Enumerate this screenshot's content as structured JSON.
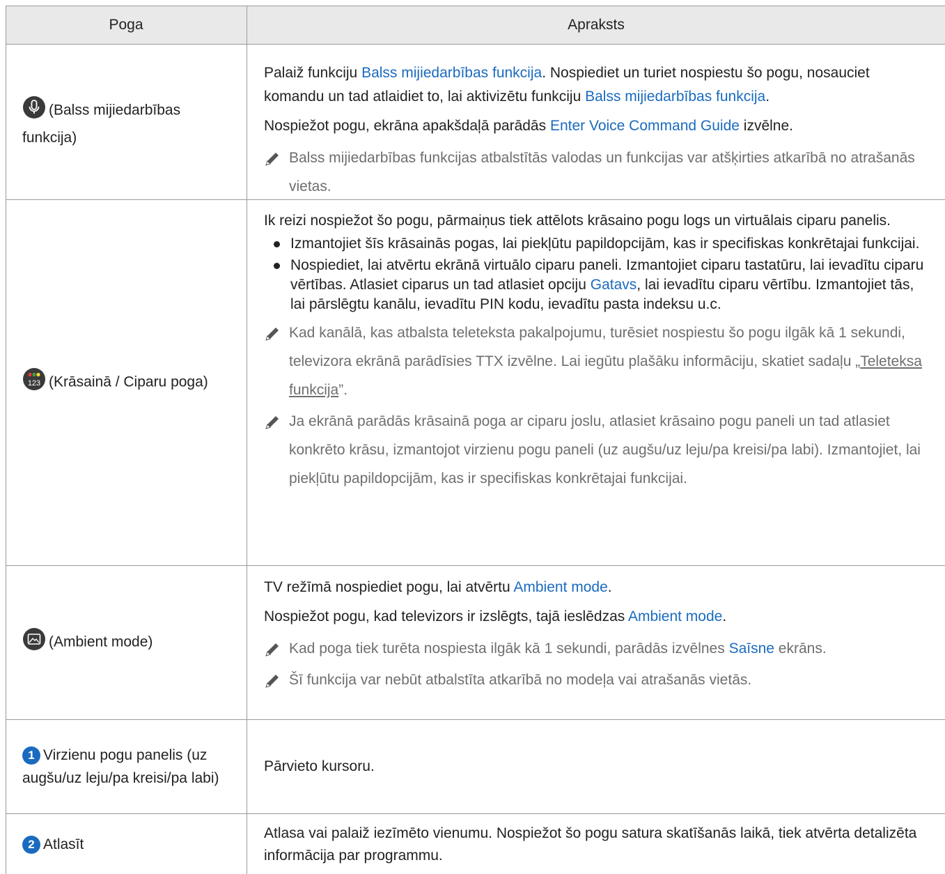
{
  "header": {
    "col_button": "Poga",
    "col_desc": "Apraksts"
  },
  "rows": [
    {
      "button": "(Balss mijiedarbības funkcija)",
      "icon": "microphone-icon",
      "desc": {
        "p1_a": "Palaiž funkciju ",
        "p1_link1": "Balss mijiedarbības funkcija",
        "p1_b": ". Nospiediet un turiet nospiestu šo pogu, nosauciet komandu un tad atlaidiet to, lai aktivizētu funkciju ",
        "p1_link2": "Balss mijiedarbības funkcija",
        "p1_c": ".",
        "p2_a": "Nospiežot pogu, ekrāna apakšdaļā parādās ",
        "p2_link": "Enter Voice Command Guide",
        "p2_b": " izvēlne.",
        "note1": "Balss mijiedarbības funkcijas atbalstītās valodas un funkcijas var atšķirties atkarībā no atrašanās vietas."
      }
    },
    {
      "button": "(Krāsainā / Ciparu poga)",
      "icon": "color-number-icon",
      "icon_text": "123",
      "desc": {
        "p1": "Ik reizi nospiežot šo pogu, pārmaiņus tiek attēlots krāsaino pogu logs un virtuālais ciparu panelis.",
        "b1": "Izmantojiet šīs krāsainās pogas, lai piekļūtu papildopcijām, kas ir specifiskas konkrētajai funkcijai.",
        "b2_a": "Nospiediet, lai atvērtu ekrānā virtuālo ciparu paneli. Izmantojiet ciparu tastatūru, lai ievadītu ciparu vērtības. Atlasiet ciparus un tad atlasiet opciju ",
        "b2_link": "Gatavs",
        "b2_b": ", lai ievadītu ciparu vērtību. Izmantojiet tās, lai pārslēgtu kanālu, ievadītu PIN kodu, ievadītu pasta indeksu u.c.",
        "note1_a": "Kad kanālā, kas atbalsta teleteksta pakalpojumu, turēsiet nospiestu šo pogu ilgāk kā 1 sekundi, televizora ekrānā parādīsies TTX izvēlne. Lai iegūtu plašāku informāciju, skatiet sadaļu „",
        "note1_link": "Teleteksa funkcija",
        "note1_b": "”.",
        "note2": "Ja ekrānā parādās krāsainā poga ar ciparu joslu, atlasiet krāsaino pogu paneli un tad atlasiet konkrēto krāsu, izmantojot virzienu pogu paneli (uz augšu/uz leju/pa kreisi/pa labi). Izmantojiet, lai piekļūtu papildopcijām, kas ir specifiskas konkrētajai funkcijai."
      }
    },
    {
      "button": "(Ambient mode)",
      "icon": "ambient-mode-icon",
      "desc": {
        "p1_a": "TV režīmā nospiediet pogu, lai atvērtu ",
        "p1_link": "Ambient mode",
        "p1_b": ".",
        "p2_a": "Nospiežot pogu, kad televizors ir izslēgts, tajā ieslēdzas ",
        "p2_link": "Ambient mode",
        "p2_b": ".",
        "note1_a": "Kad poga tiek turēta nospiesta ilgāk kā 1 sekundi, parādās izvēlnes ",
        "note1_link": "Saīsne",
        "note1_b": " ekrāns.",
        "note2": "Šī funkcija var nebūt atbalstīta atkarībā no modeļa vai atrašanās vietās."
      }
    },
    {
      "number": "1",
      "button": "Virzienu pogu panelis (uz augšu/uz leju/pa kreisi/pa labi)",
      "desc": {
        "p1": "Pārvieto kursoru."
      }
    },
    {
      "number": "2",
      "button": "Atlasīt",
      "desc": {
        "p1": "Atlasa vai palaiž iezīmēto vienumu. Nospiežot šo pogu satura skatīšanās laikā, tiek atvērta detalizēta informācija par programmu."
      }
    }
  ],
  "colors": {
    "link": "#1a6bbf",
    "note": "#6e6e6e",
    "header_bg": "#e9e9e9",
    "border": "#9a9a9a"
  }
}
